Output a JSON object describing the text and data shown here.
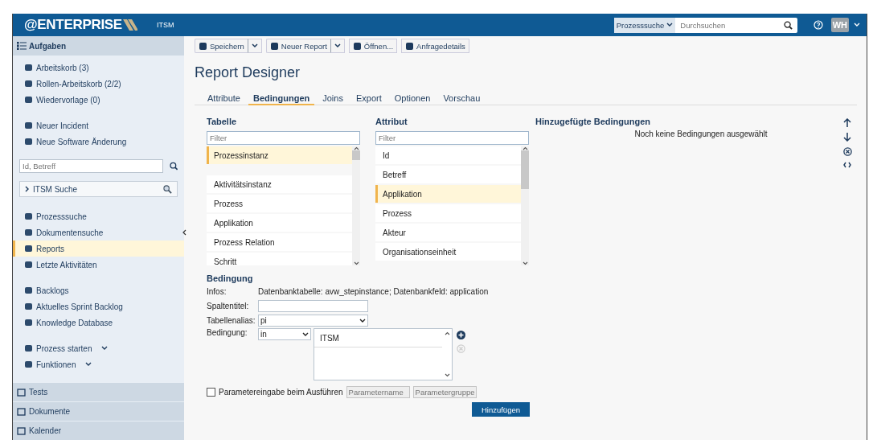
{
  "header": {
    "logo": "@ENTERPRISE",
    "app": "ITSM",
    "search_scope": "Prozesssuche",
    "search_placeholder": "Durchsuchen",
    "avatar": "WH"
  },
  "sidebar": {
    "title": "Aufgaben",
    "groups": [
      [
        {
          "label": "Arbeitskorb (3)",
          "selected": false
        },
        {
          "label": "Rollen-Arbeitskorb  (2/2)",
          "selected": false
        },
        {
          "label": "Wiedervorlage  (0)",
          "selected": false
        }
      ],
      [
        {
          "label": "Neuer Incident",
          "selected": false
        },
        {
          "label": "Neue Software Änderung",
          "selected": false
        }
      ]
    ],
    "search_placeholder": "Id, Betreff",
    "itsm_search": "ITSM Suche",
    "groups2": [
      [
        {
          "label": "Prozesssuche",
          "selected": false
        },
        {
          "label": "Dokumentensuche",
          "selected": false
        },
        {
          "label": "Reports",
          "selected": true
        },
        {
          "label": "Letzte Aktivitäten",
          "selected": false
        }
      ],
      [
        {
          "label": "Backlogs",
          "selected": false
        },
        {
          "label": "Aktuelles Sprint Backlog",
          "selected": false
        },
        {
          "label": "Knowledge Database",
          "selected": false
        }
      ],
      [
        {
          "label": "Prozess starten",
          "selected": false
        },
        {
          "label": "Funktionen",
          "selected": false
        }
      ]
    ],
    "sections": [
      "Tests",
      "Dokumente",
      "Kalender"
    ]
  },
  "toolbar": [
    {
      "label": "Speichern",
      "split": true
    },
    {
      "label": "Neuer Report",
      "split": true
    },
    {
      "label": "Öffnen...",
      "split": false
    },
    {
      "label": "Anfragedetails",
      "split": false
    }
  ],
  "title": "Report Designer",
  "tabs": [
    {
      "label": "Attribute",
      "selected": false
    },
    {
      "label": "Bedingungen",
      "selected": true
    },
    {
      "label": "Joins",
      "selected": false
    },
    {
      "label": "Export",
      "selected": false
    },
    {
      "label": "Optionen",
      "selected": false
    },
    {
      "label": "Vorschau",
      "selected": false
    }
  ],
  "tabelle": {
    "title": "Tabelle",
    "placeholder": "Filter",
    "items": [
      {
        "label": "Prozessinstanz",
        "selected": true
      },
      {
        "label": "Aktivitätsinstanz",
        "selected": false
      },
      {
        "label": "Prozess",
        "selected": false
      },
      {
        "label": "Applikation",
        "selected": false
      },
      {
        "label": "Prozess Relation",
        "selected": false
      },
      {
        "label": "Schritt",
        "selected": false
      }
    ]
  },
  "attribut": {
    "title": "Attribut",
    "placeholder": "Filter",
    "items": [
      {
        "label": "Id",
        "selected": false
      },
      {
        "label": "Betreff",
        "selected": false
      },
      {
        "label": "Applikation",
        "selected": true
      },
      {
        "label": "Prozess",
        "selected": false
      },
      {
        "label": "Akteur",
        "selected": false
      },
      {
        "label": "Organisationseinheit",
        "selected": false
      }
    ]
  },
  "added": {
    "title": "Hinzugefügte Bedingungen",
    "empty": "Noch keine Bedingungen ausgewählt"
  },
  "bedingung": {
    "title": "Bedingung",
    "infos_label": "Infos:",
    "infos": "Datenbanktabelle: avw_stepinstance; Datenbankfeld: application",
    "spaltentitel_label": "Spaltentitel:",
    "alias_label": "Tabellenalias:",
    "alias": "pi",
    "cond_label": "Bedingung:",
    "operator": "in",
    "values": [
      "ITSM"
    ],
    "param_checked": false,
    "param_label": "Parametereingabe beim Ausführen",
    "param_name": {
      "placeholder": "Parametername"
    },
    "param_group": {
      "placeholder": "Parametergruppe"
    },
    "submit": "Hinzufügen"
  }
}
